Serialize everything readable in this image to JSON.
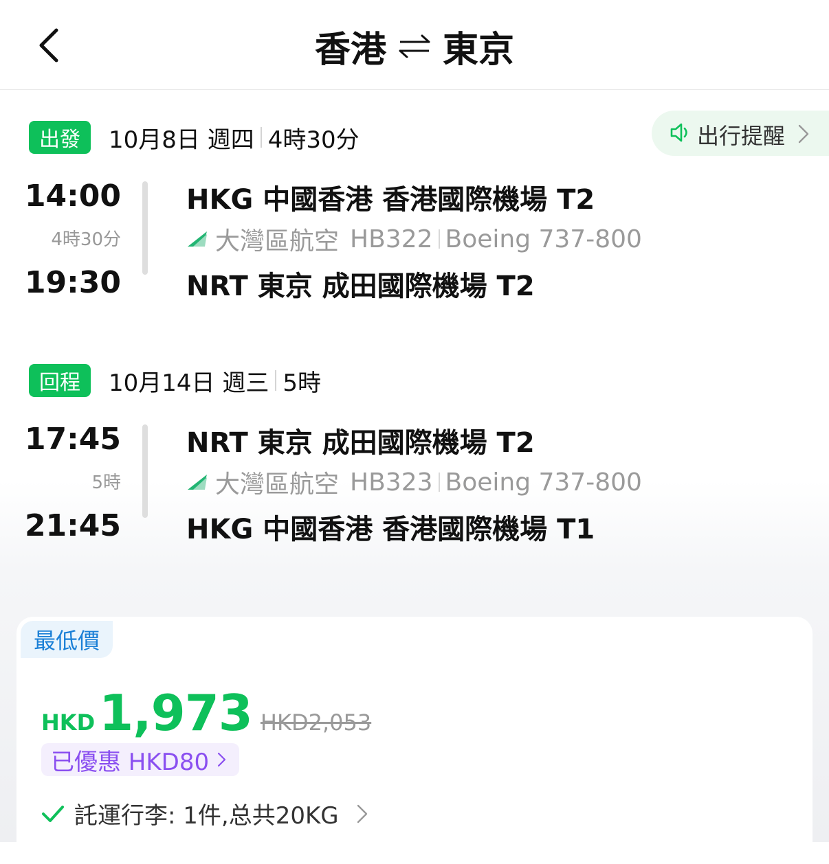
{
  "header": {
    "origin": "香港",
    "destination": "東京"
  },
  "reminder": {
    "label": "出行提醒"
  },
  "outbound": {
    "tag": "出發",
    "date": "10月8日 週四",
    "total_duration": "4時30分",
    "depart_time": "14:00",
    "segment_duration": "4時30分",
    "arrive_time": "19:30",
    "depart_airport": "HKG 中國香港 香港國際機場 T2",
    "airline": "大灣區航空",
    "flight_no": "HB322",
    "aircraft": "Boeing 737-800",
    "arrive_airport": "NRT 東京 成田國際機場 T2"
  },
  "return": {
    "tag": "回程",
    "date": "10月14日 週三",
    "total_duration": "5時",
    "depart_time": "17:45",
    "segment_duration": "5時",
    "arrive_time": "21:45",
    "depart_airport": "NRT 東京 成田國際機場 T2",
    "airline": "大灣區航空",
    "flight_no": "HB323",
    "aircraft": "Boeing 737-800",
    "arrive_airport": "HKG 中國香港 香港國際機場 T1"
  },
  "price": {
    "badge": "最低價",
    "currency": "HKD",
    "amount": "1,973",
    "original": "HKD2,053",
    "discount": "已優惠 HKD80",
    "baggage": "託運行李: 1件,总共20KG"
  },
  "colors": {
    "accent": "#0ec05a",
    "discount": "#8a4ff0",
    "badge_text": "#1a7fd6"
  }
}
